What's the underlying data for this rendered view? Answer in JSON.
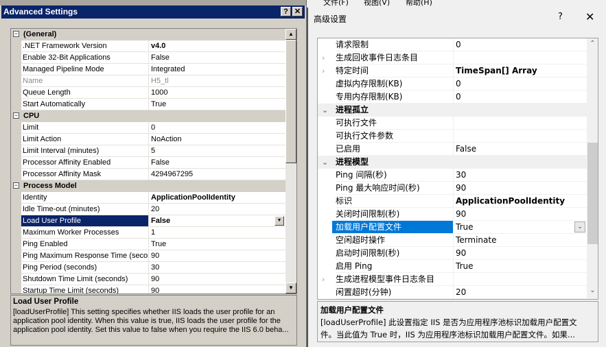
{
  "left": {
    "title": "Advanced Settings",
    "help_label": "?",
    "close_label": "✕",
    "rows": [
      {
        "type": "category",
        "label": "(General)",
        "toggle": "−"
      },
      {
        "label": ".NET Framework Version",
        "value": "v4.0",
        "bold": true
      },
      {
        "label": "Enable 32-Bit Applications",
        "value": "False"
      },
      {
        "label": "Managed Pipeline Mode",
        "value": "Integrated"
      },
      {
        "label": "Name",
        "value": "H5_tl",
        "disabled": true
      },
      {
        "label": "Queue Length",
        "value": "1000"
      },
      {
        "label": "Start Automatically",
        "value": "True"
      },
      {
        "type": "category",
        "label": "CPU",
        "toggle": "−"
      },
      {
        "label": "Limit",
        "value": "0"
      },
      {
        "label": "Limit Action",
        "value": "NoAction"
      },
      {
        "label": "Limit Interval (minutes)",
        "value": "5"
      },
      {
        "label": "Processor Affinity Enabled",
        "value": "False"
      },
      {
        "label": "Processor Affinity Mask",
        "value": "4294967295"
      },
      {
        "type": "category",
        "label": "Process Model",
        "toggle": "−"
      },
      {
        "label": "Identity",
        "value": "ApplicationPoolIdentity",
        "bold": true
      },
      {
        "label": "Idle Time-out (minutes)",
        "value": "20"
      },
      {
        "label": "Load User Profile",
        "value": "False",
        "bold": true,
        "selected": true
      },
      {
        "label": "Maximum Worker Processes",
        "value": "1"
      },
      {
        "label": "Ping Enabled",
        "value": "True"
      },
      {
        "label": "Ping Maximum Response Time (seconds)",
        "value": "90"
      },
      {
        "label": "Ping Period (seconds)",
        "value": "30"
      },
      {
        "label": "Shutdown Time Limit (seconds)",
        "value": "90"
      },
      {
        "label": "Startup Time Limit (seconds)",
        "value": "90"
      }
    ],
    "description": {
      "title": "Load User Profile",
      "text": "[loadUserProfile] This setting specifies whether IIS loads the user profile for an application pool identity. When this value is true, IIS loads the user profile for the application pool identity. Set this value to false when you require the IIS 6.0 beha..."
    }
  },
  "right": {
    "menu": [
      "文件(F)",
      "视图(V)",
      "帮助(H)"
    ],
    "title": "高级设置",
    "help_label": "?",
    "close_label": "✕",
    "rows": [
      {
        "label": "请求限制",
        "value": "0"
      },
      {
        "label": "生成回收事件日志条目",
        "value": "",
        "expander": "›"
      },
      {
        "label": "特定时间",
        "value": "TimeSpan[] Array",
        "bold": true,
        "expander": "›"
      },
      {
        "label": "虚拟内存限制(KB)",
        "value": "0"
      },
      {
        "label": "专用内存限制(KB)",
        "value": "0"
      },
      {
        "type": "category",
        "label": "进程孤立",
        "expander": "⌄"
      },
      {
        "label": "可执行文件",
        "value": ""
      },
      {
        "label": "可执行文件参数",
        "value": ""
      },
      {
        "label": "已启用",
        "value": "False"
      },
      {
        "type": "category",
        "label": "进程模型",
        "expander": "⌄"
      },
      {
        "label": "Ping 间隔(秒)",
        "value": "30"
      },
      {
        "label": "Ping 最大响应时间(秒)",
        "value": "90"
      },
      {
        "label": "标识",
        "value": "ApplicationPoolIdentity",
        "bold": true
      },
      {
        "label": "关闭时间限制(秒)",
        "value": "90"
      },
      {
        "label": "加载用户配置文件",
        "value": "True",
        "selected": true
      },
      {
        "label": "空闲超时操作",
        "value": "Terminate"
      },
      {
        "label": "启动时间限制(秒)",
        "value": "90"
      },
      {
        "label": "启用 Ping",
        "value": "True"
      },
      {
        "label": "生成进程模型事件日志条目",
        "value": "",
        "expander": "›"
      },
      {
        "label": "闲置超时(分钟)",
        "value": "20"
      }
    ],
    "description": {
      "title": "加载用户配置文件",
      "line1": "[loadUserProfile] 此设置指定 IIS 是否为应用程序池标识加载用户配置文",
      "line2": "件。当此值为 True 时，IIS 为应用程序池标识加载用户配置文件。如果..."
    }
  }
}
